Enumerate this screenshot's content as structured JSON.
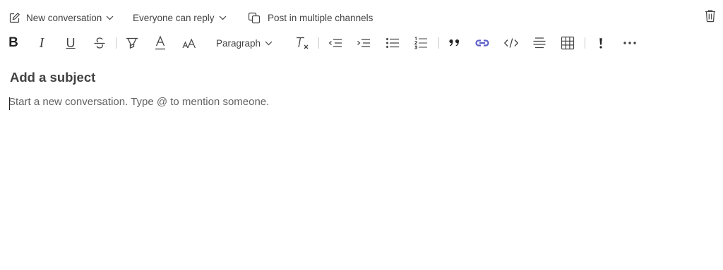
{
  "topbar": {
    "new_conversation_label": "New conversation",
    "reply_setting_label": "Everyone can reply",
    "post_multiple_label": "Post in multiple channels"
  },
  "toolbar": {
    "bold_label": "B",
    "italic_label": "I",
    "underline_label": "U",
    "paragraph_label": "Paragraph",
    "more_label": "···"
  },
  "compose": {
    "subject_placeholder": "Add a subject",
    "body_placeholder": "Start a new conversation. Type @ to mention someone."
  },
  "colors": {
    "link_icon": "#5b5fc7",
    "text": "#424242",
    "placeholder": "#616161"
  }
}
